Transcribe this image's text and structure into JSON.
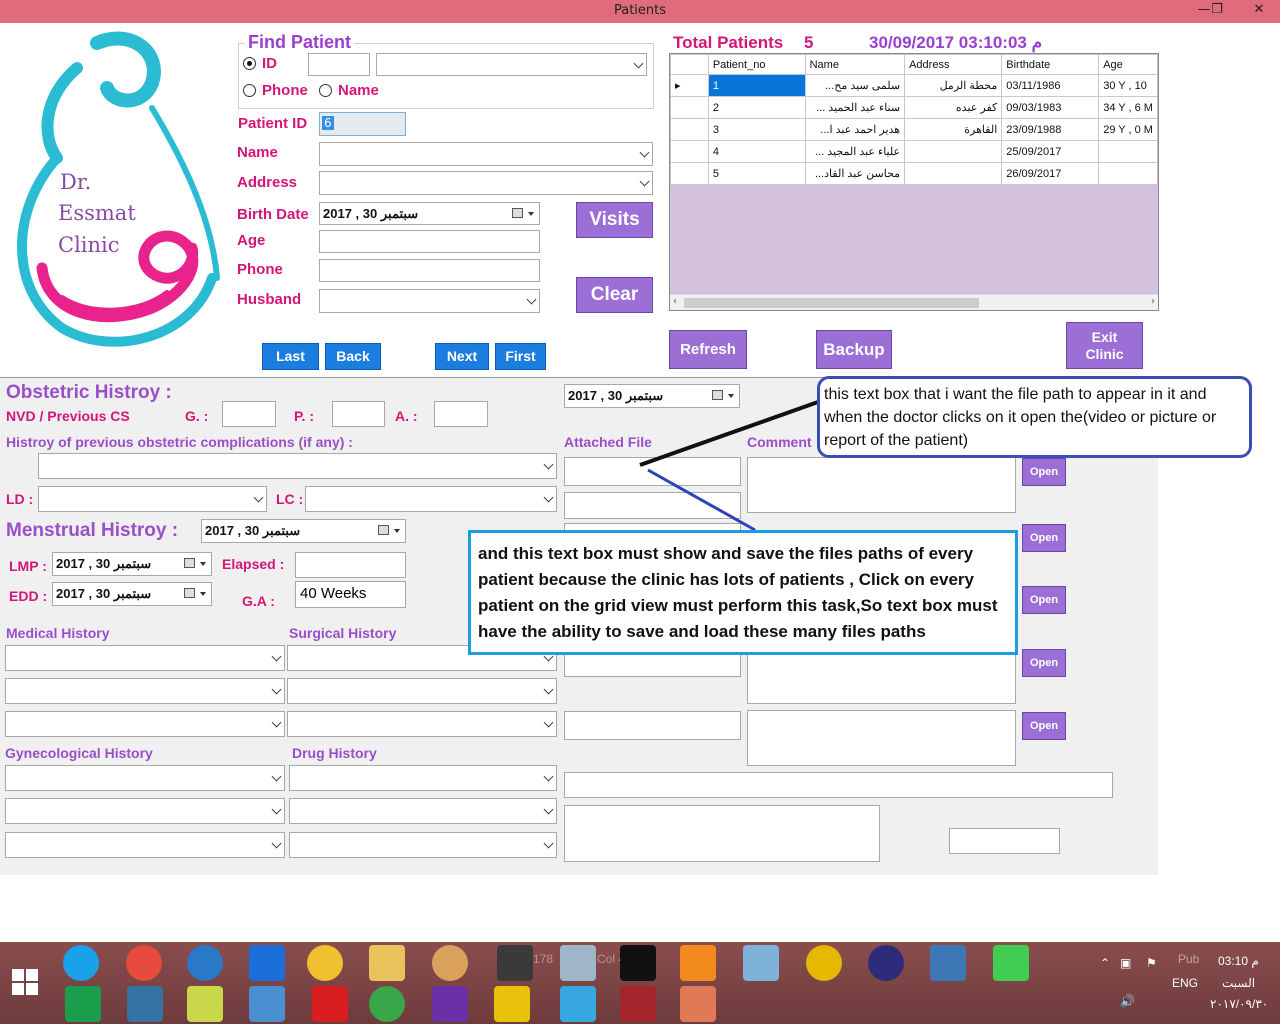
{
  "window": {
    "title": "Patients",
    "min": "—",
    "max": "❐",
    "close": "✕"
  },
  "logo": {
    "line1": "Dr.",
    "line2": "Essmat",
    "line3": "Clinic"
  },
  "find": {
    "title": "Find Patient",
    "id_label": "ID",
    "phone_label": "Phone",
    "name_label": "Name",
    "selected": "ID"
  },
  "form": {
    "patient_id_label": "Patient ID",
    "patient_id_value": "6",
    "name_label": "Name",
    "address_label": "Address",
    "birth_label": "Birth Date",
    "birth_value": "2017 , سبتمبر   30",
    "age_label": "Age",
    "phone_label": "Phone",
    "husband_label": "Husband"
  },
  "buttons": {
    "visits": "Visits",
    "clear": "Clear",
    "last": "Last",
    "back": "Back",
    "next": "Next",
    "first": "First",
    "refresh": "Refresh",
    "backup": "Backup",
    "exit_line1": "Exit",
    "exit_line2": "Clinic",
    "open": "Open"
  },
  "summary": {
    "total_label": "Total Patients",
    "total_value": "5",
    "datetime": "30/09/2017 03:10:03 م"
  },
  "grid": {
    "columns": [
      "Patient_no",
      "Name",
      "Address",
      "Birthdate",
      "Age"
    ],
    "rows": [
      [
        "1",
        "سلمى سيد مح...",
        "محطة الرمل",
        "03/11/1986",
        "30 Y , 10"
      ],
      [
        "2",
        "سناء عبد الحميد ...",
        "كفر عبده",
        "09/03/1983",
        "34 Y , 6 M"
      ],
      [
        "3",
        "هدير احمد عبد ا...",
        "القاهرة",
        "23/09/1988",
        "29 Y , 0 M"
      ],
      [
        "4",
        "علياء عبد المجيد ...",
        "",
        "25/09/2017",
        ""
      ],
      [
        "5",
        "محاسن عبد القاد...",
        "",
        "26/09/2017",
        ""
      ]
    ]
  },
  "obstetric": {
    "title": "Obstetric Histroy :",
    "nvd": "NVD / Previous CS",
    "g": "G. :",
    "p": "P. :",
    "a": "A. :",
    "complications": "Histroy of previous obstetric complications (if any) :",
    "ld": "LD :",
    "lc": "LC :",
    "date_value": "2017 , سبتمبر   30"
  },
  "menstrual": {
    "title": "Menstrual Histroy :",
    "date_value": "2017 , سبتمبر   30",
    "lmp": "LMP :",
    "lmp_value": "2017 , سبتمبر   30",
    "edd": "EDD :",
    "edd_value": "2017 , سبتمبر   30",
    "elapsed": "Elapsed :",
    "ga": "G.A :",
    "ga_value": "40  Weeks"
  },
  "history": {
    "medical": "Medical History",
    "surgical": "Surgical History",
    "gyne": "Gynecological History",
    "drug": "Drug History"
  },
  "attach": {
    "attached_label": "Attached File",
    "comment_label": "Comment"
  },
  "callouts": {
    "top": "this text box that i want the file path to appear in it and when the doctor clicks on it open the(video or picture or report of the patient)",
    "bottom": "and this text box must show and save the files paths of every patient because the clinic has lots of patients , Click on every patient on the grid view must perform this task,So text box must have the ability to save and load these many files paths"
  },
  "taskbar": {
    "lang": "ENG",
    "time": "03:10 م",
    "day": "السبت",
    "date": "٢٠١٧/٠٩/٣٠",
    "ghost1": "Col 4",
    "ghost2": "178",
    "ghost3": "Pub"
  }
}
